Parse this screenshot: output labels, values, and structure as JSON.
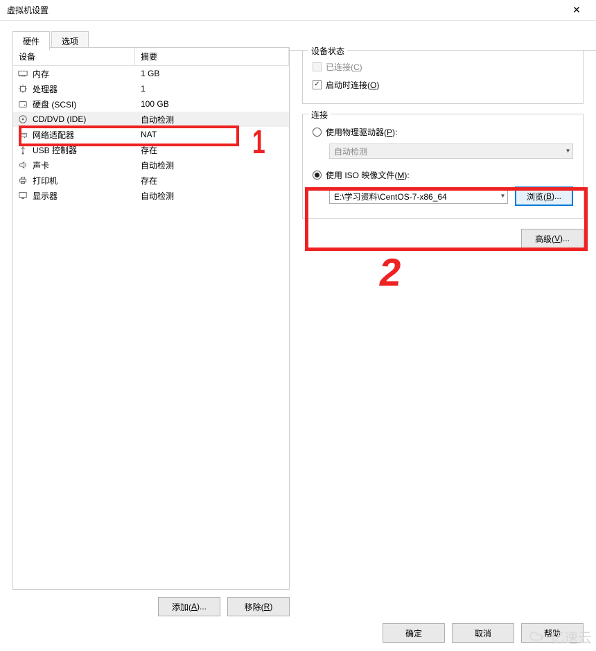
{
  "title": "虚拟机设置",
  "tabs": {
    "hardware": "硬件",
    "options": "选项"
  },
  "columns": {
    "device": "设备",
    "summary": "摘要"
  },
  "devices": [
    {
      "id": "memory",
      "label": "内存",
      "summary": "1 GB",
      "icon": "memory"
    },
    {
      "id": "cpu",
      "label": "处理器",
      "summary": "1",
      "icon": "cpu"
    },
    {
      "id": "disk",
      "label": "硬盘 (SCSI)",
      "summary": "100 GB",
      "icon": "disk"
    },
    {
      "id": "cddvd",
      "label": "CD/DVD (IDE)",
      "summary": "自动检测",
      "icon": "disc",
      "selected": true
    },
    {
      "id": "net",
      "label": "网络适配器",
      "summary": "NAT",
      "icon": "net"
    },
    {
      "id": "usb",
      "label": "USB 控制器",
      "summary": "存在",
      "icon": "usb"
    },
    {
      "id": "sound",
      "label": "声卡",
      "summary": "自动检测",
      "icon": "sound"
    },
    {
      "id": "printer",
      "label": "打印机",
      "summary": "存在",
      "icon": "printer"
    },
    {
      "id": "display",
      "label": "显示器",
      "summary": "自动检测",
      "icon": "display"
    }
  ],
  "left_buttons": {
    "add": "添加(A)...",
    "remove": "移除(R)"
  },
  "status": {
    "title": "设备状态",
    "connected": "已连接(C)",
    "connect_on_start": "启动时连接(O)"
  },
  "connection": {
    "title": "连接",
    "physical": "使用物理驱动器(P):",
    "physical_value": "自动检测",
    "iso": "使用 ISO 映像文件(M):",
    "iso_value": "E:\\学习资料\\CentOS-7-x86_64",
    "browse": "浏览(B)..."
  },
  "advanced": "高级(V)...",
  "footer": {
    "ok": "确定",
    "cancel": "取消",
    "help": "帮助"
  },
  "annotations": {
    "one": "1",
    "two": "2"
  },
  "watermark": "亿速云"
}
